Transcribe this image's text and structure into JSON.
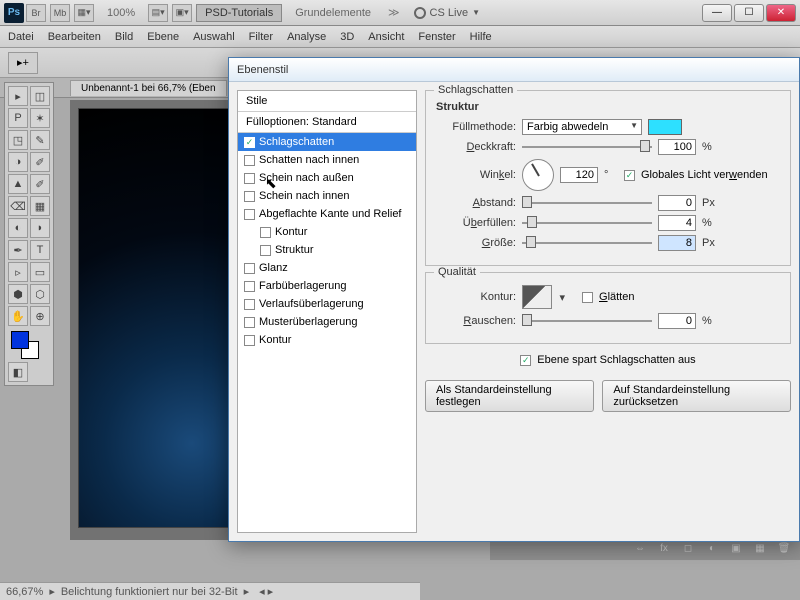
{
  "titlebar": {
    "logo": "Ps",
    "br": "Br",
    "mb": "Mb",
    "zoom": "100%",
    "psd_tutorials": "PSD-Tutorials",
    "grundelemente": "Grundelemente",
    "cs_live": "CS Live"
  },
  "menu": {
    "items": [
      "Datei",
      "Bearbeiten",
      "Bild",
      "Ebene",
      "Auswahl",
      "Filter",
      "Analyse",
      "3D",
      "Ansicht",
      "Fenster",
      "Hilfe"
    ]
  },
  "doctab": "Unbenannt-1 bei 66,7% (Eben",
  "status": {
    "zoom": "66,67%",
    "msg": "Belichtung funktioniert nur bei 32-Bit"
  },
  "dialog": {
    "title": "Ebenenstil",
    "styles_header": "Stile",
    "fill_opts": "Fülloptionen: Standard",
    "items": [
      {
        "label": "Schlagschatten",
        "checked": true,
        "selected": true
      },
      {
        "label": "Schatten nach innen",
        "checked": false
      },
      {
        "label": "Schein nach außen",
        "checked": false
      },
      {
        "label": "Schein nach innen",
        "checked": false
      },
      {
        "label": "Abgeflachte Kante und Relief",
        "checked": false
      },
      {
        "label": "Kontur",
        "checked": false,
        "indent": true
      },
      {
        "label": "Struktur",
        "checked": false,
        "indent": true
      },
      {
        "label": "Glanz",
        "checked": false
      },
      {
        "label": "Farbüberlagerung",
        "checked": false
      },
      {
        "label": "Verlaufsüberlagerung",
        "checked": false
      },
      {
        "label": "Musterüberlagerung",
        "checked": false
      },
      {
        "label": "Kontur",
        "checked": false
      }
    ],
    "group1_title": "Schlagschatten",
    "structure_label": "Struktur",
    "blend_label": "Füllmethode:",
    "blend_value": "Farbig abwedeln",
    "opacity_label": "Deckkraft:",
    "opacity_value": "100",
    "opacity_unit": "%",
    "angle_label": "Winkel:",
    "angle_value": "120",
    "angle_unit": "°",
    "global_light": "Globales Licht verwenden",
    "distance_label": "Abstand:",
    "distance_value": "0",
    "distance_unit": "Px",
    "spread_label": "Überfüllen:",
    "spread_value": "4",
    "spread_unit": "%",
    "size_label": "Größe:",
    "size_value": "8",
    "size_unit": "Px",
    "quality_label": "Qualität",
    "contour_label": "Kontur:",
    "antialias": "Glätten",
    "noise_label": "Rauschen:",
    "noise_value": "0",
    "noise_unit": "%",
    "knockout": "Ebene spart Schlagschatten aus",
    "btn_default": "Als Standardeinstellung festlegen",
    "btn_reset": "Auf Standardeinstellung zurücksetzen",
    "blend_color": "#2de0ff"
  },
  "tool_icons": [
    "▸",
    "▦",
    "◫",
    "✶",
    "◳",
    "✂",
    "◢",
    "◑",
    "✎",
    "⟋",
    "◒",
    "⌫",
    "⬤",
    "▭",
    "◐",
    "T",
    "▹",
    "◻",
    "✋",
    "⊕",
    "◧",
    "Q"
  ]
}
